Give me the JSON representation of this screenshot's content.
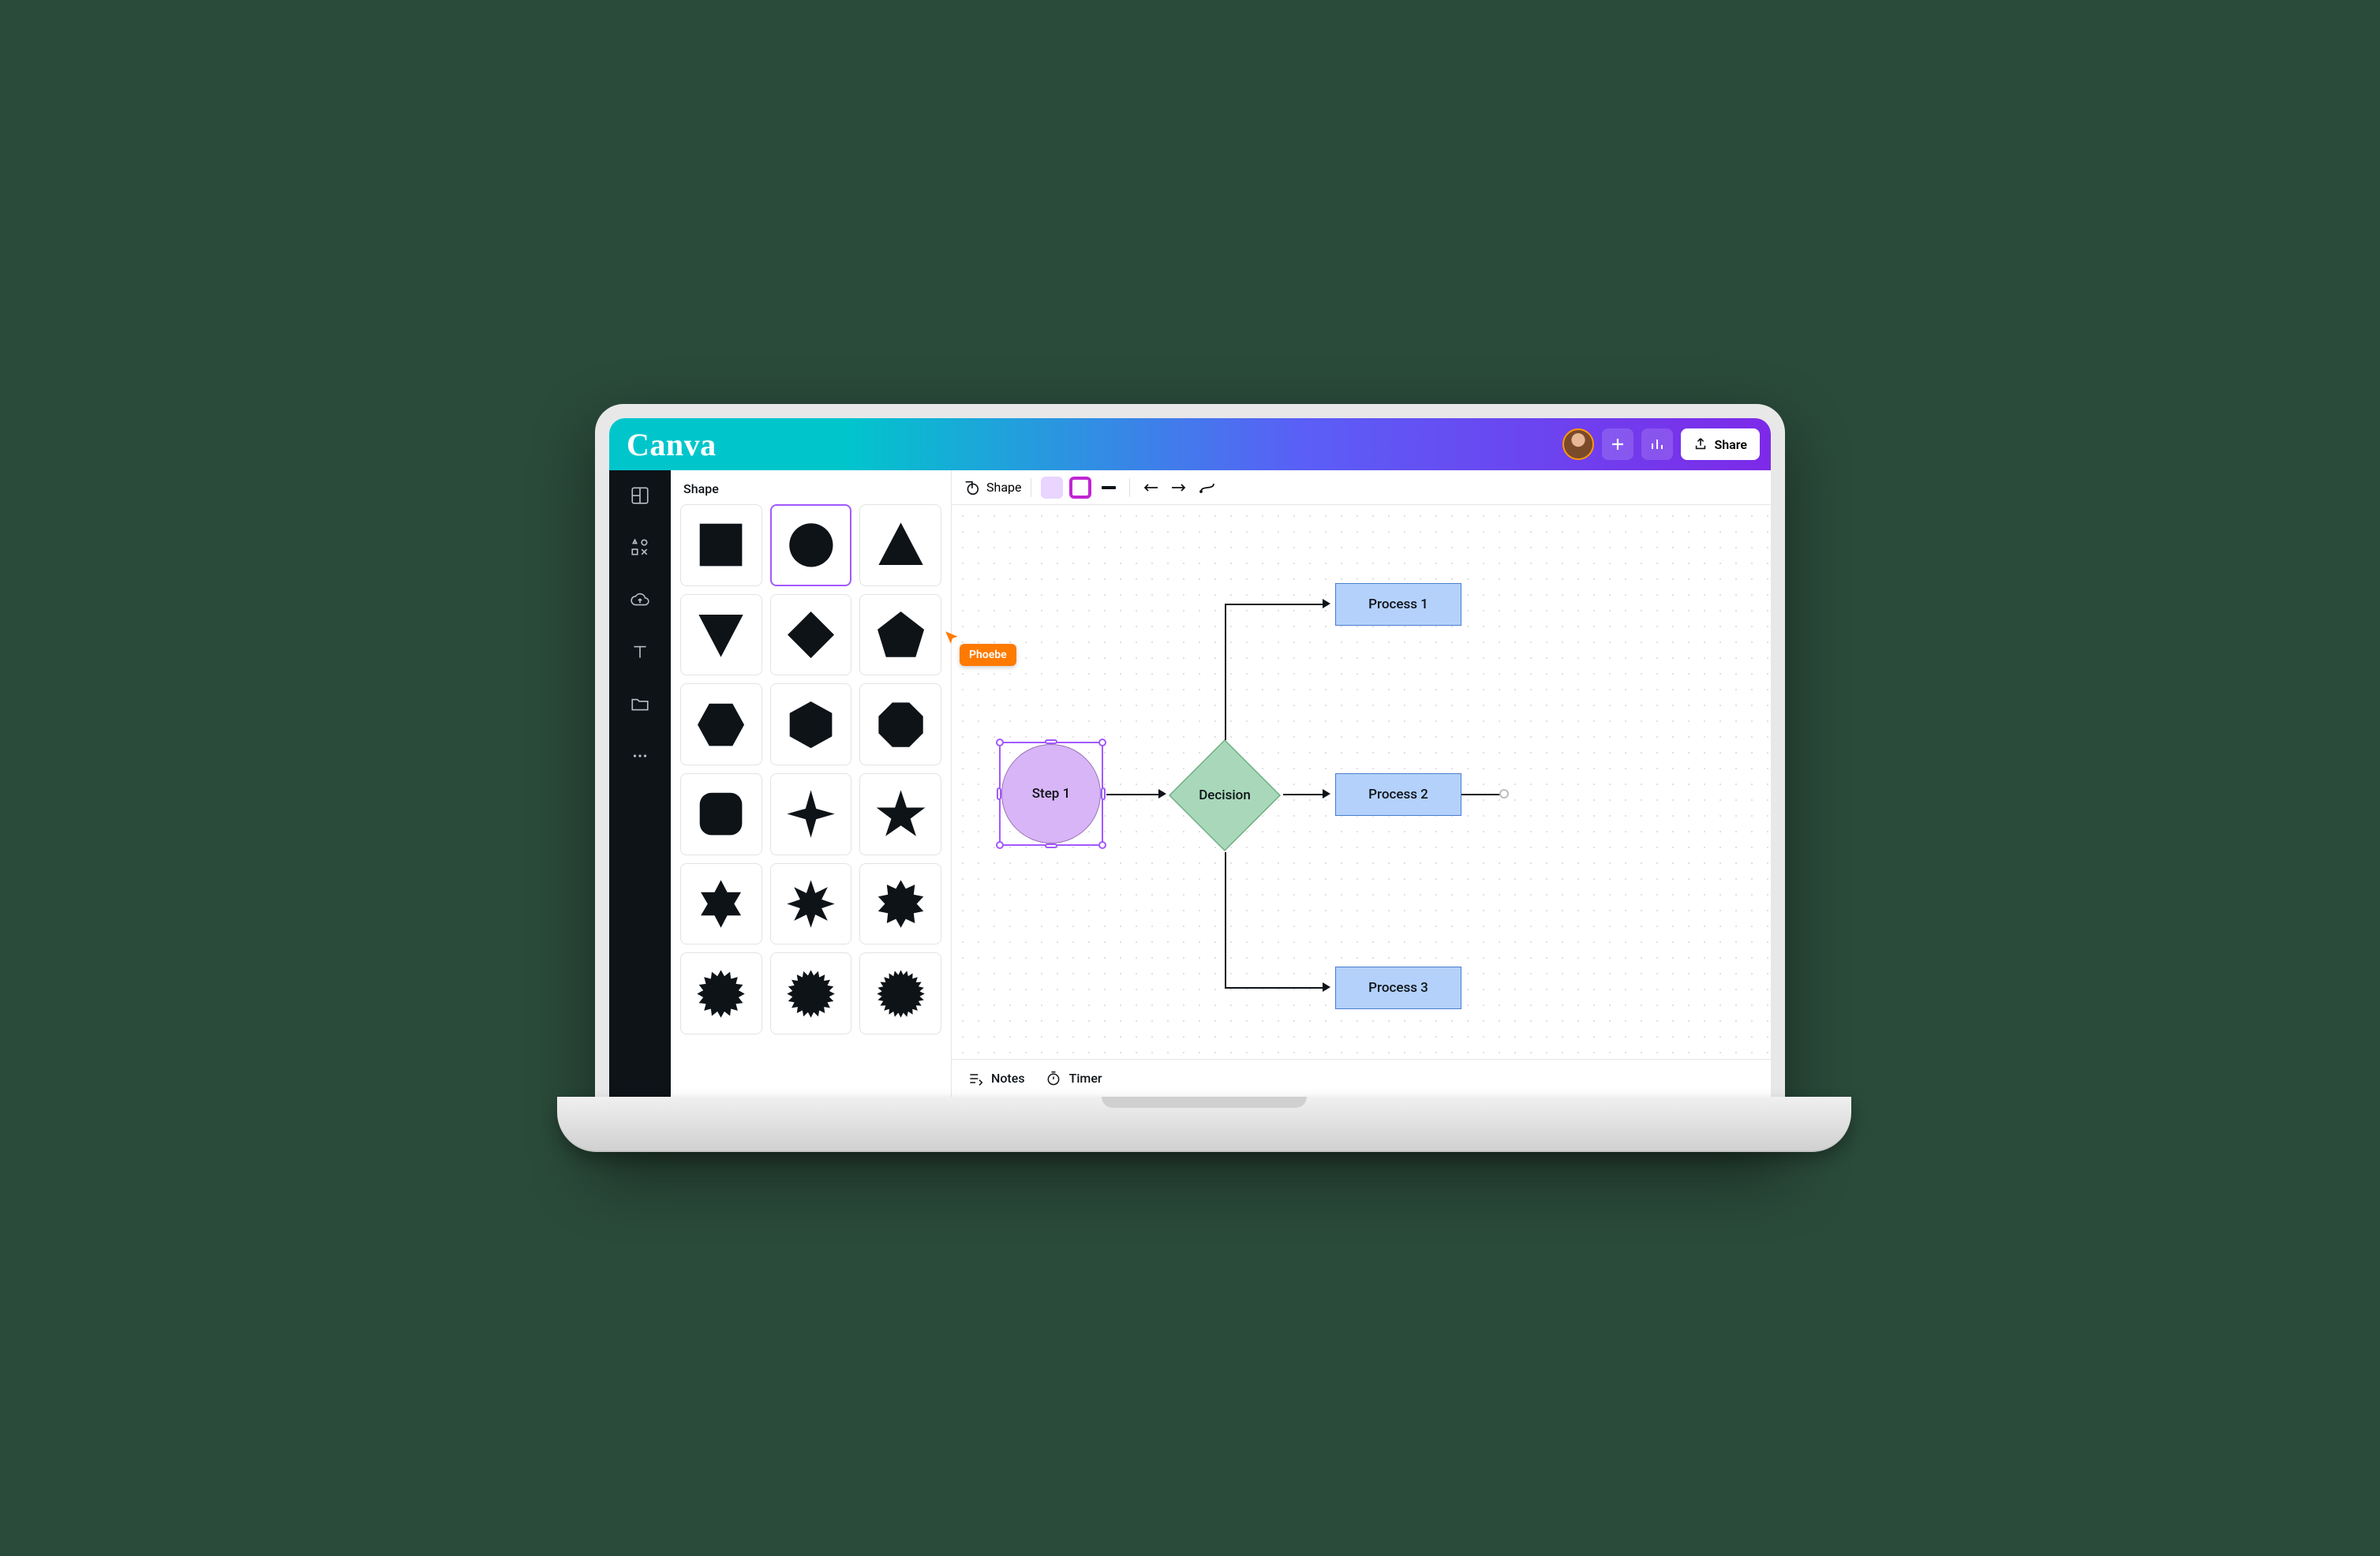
{
  "app": {
    "brand": "Canva"
  },
  "top": {
    "share_label": "Share"
  },
  "sidebar_panel": {
    "title": "Shape",
    "shapes": [
      {
        "name": "square"
      },
      {
        "name": "circle",
        "selected": true
      },
      {
        "name": "triangle"
      },
      {
        "name": "triangle-down"
      },
      {
        "name": "diamond"
      },
      {
        "name": "pentagon"
      },
      {
        "name": "hexagon"
      },
      {
        "name": "hexagon-pointy"
      },
      {
        "name": "octagon-alt"
      },
      {
        "name": "rounded-square"
      },
      {
        "name": "star-4"
      },
      {
        "name": "star-5"
      },
      {
        "name": "star-6"
      },
      {
        "name": "star-8"
      },
      {
        "name": "burst-10"
      },
      {
        "name": "burst-16"
      },
      {
        "name": "burst-20"
      },
      {
        "name": "burst-24"
      }
    ]
  },
  "context_toolbar": {
    "shape_label": "Shape",
    "colors": {
      "fill": "#e9d5ff",
      "outline": "#c026d3",
      "line": "#0e1318"
    }
  },
  "collab": {
    "user_name": "Phoebe",
    "color": "#ff7a00"
  },
  "canvas": {
    "nodes": {
      "step1": {
        "label": "Step 1",
        "type": "circle",
        "selected": true
      },
      "decision": {
        "label": "Decision",
        "type": "diamond",
        "fill": "#a8d8b9"
      },
      "process1": {
        "label": "Process 1",
        "type": "rect"
      },
      "process2": {
        "label": "Process 2",
        "type": "rect"
      },
      "process3": {
        "label": "Process 3",
        "type": "rect"
      }
    }
  },
  "bottom": {
    "notes_label": "Notes",
    "timer_label": "Timer"
  }
}
